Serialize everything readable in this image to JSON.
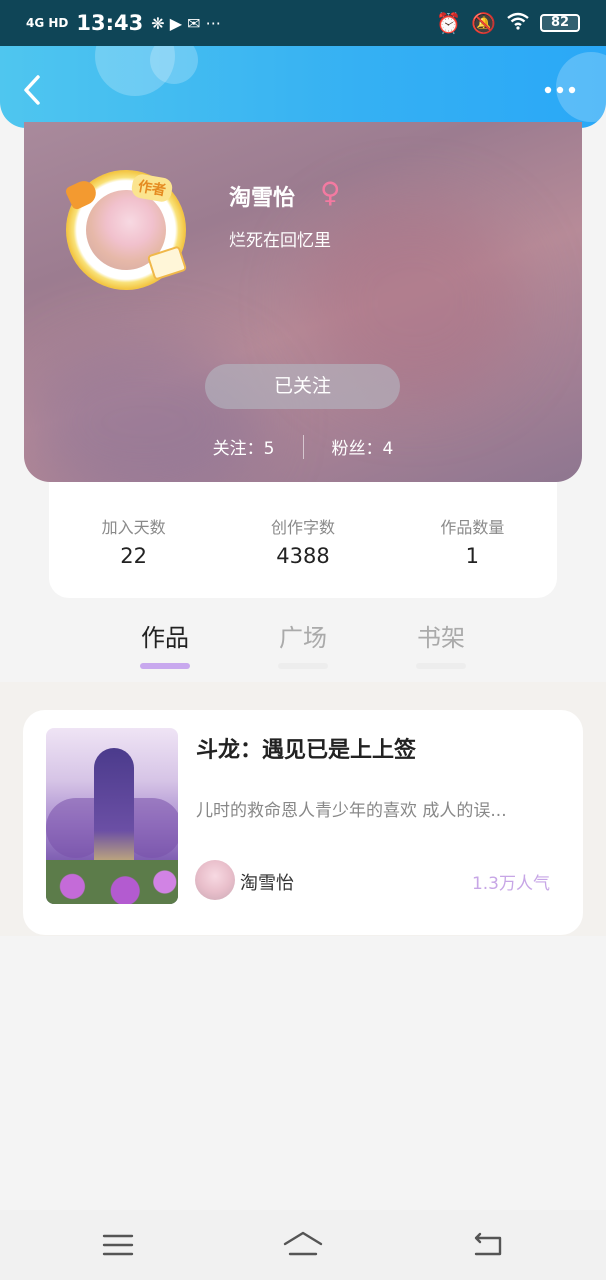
{
  "status_bar": {
    "network": "4G HD",
    "time": "13:43",
    "battery": "82"
  },
  "header": {
    "back_icon": "chevron-left-icon",
    "more_icon": "more-dots-icon"
  },
  "profile": {
    "name": "淘雪怡",
    "gender_symbol": "♀",
    "signature": "烂死在回忆里",
    "badge": "作者",
    "follow_button": "已关注",
    "following": "关注：5",
    "followers": "粉丝：4"
  },
  "info": [
    {
      "label": "加入天数",
      "value": "22"
    },
    {
      "label": "创作字数",
      "value": "4388"
    },
    {
      "label": "作品数量",
      "value": "1"
    }
  ],
  "tabs": [
    {
      "label": "作品",
      "active": true
    },
    {
      "label": "广场",
      "active": false
    },
    {
      "label": "书架",
      "active": false
    }
  ],
  "work": {
    "title": "斗龙：遇见已是上上签",
    "description": "儿时的救命恩人青少年的喜欢 成人的误...",
    "author": "淘雪怡",
    "popularity": "1.3万人气"
  },
  "colors": {
    "header_blue": "#35b0f3",
    "tab_indicator": "#c8a8ee",
    "popularity": "#c7a6e6",
    "gender": "#f37aa1"
  }
}
